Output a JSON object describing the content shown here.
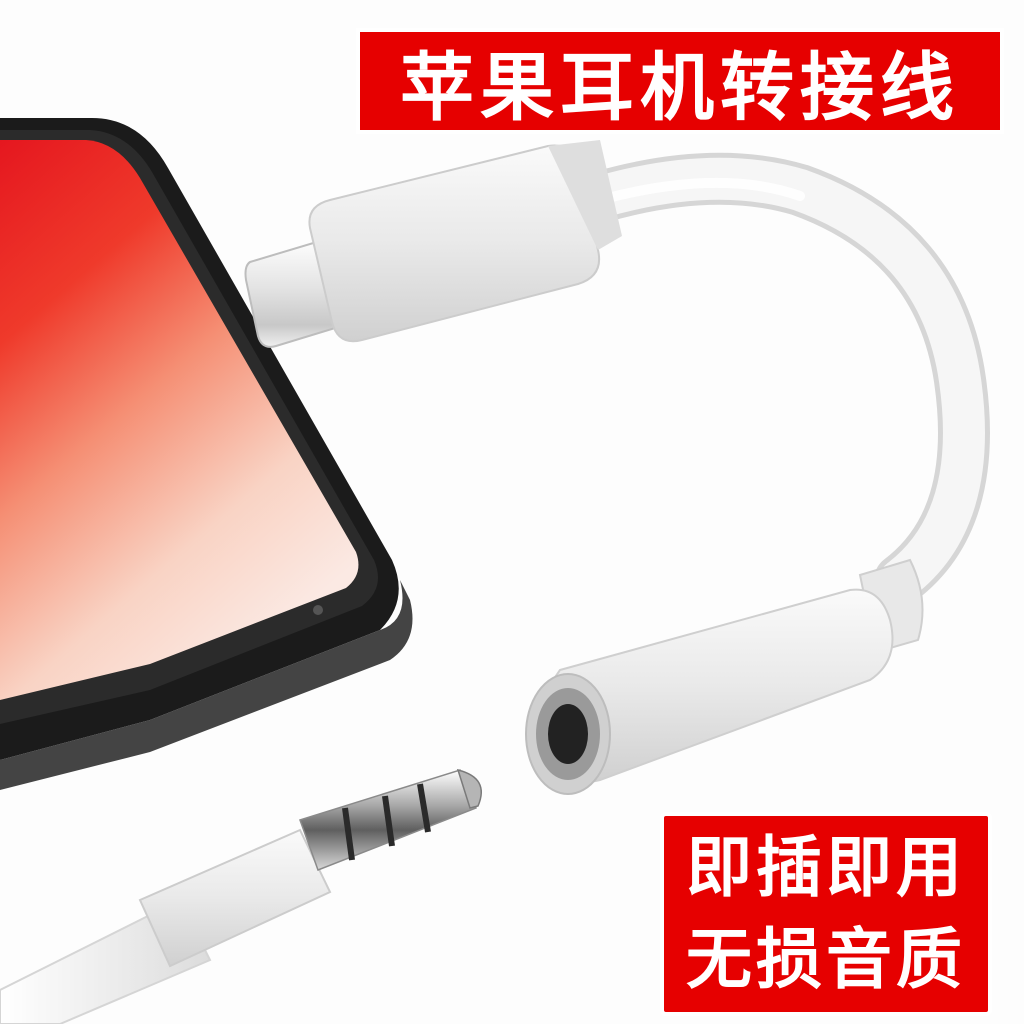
{
  "title": "苹果耳机转接线",
  "features": [
    "即插即用",
    "无损音质"
  ],
  "colors": {
    "banner": "#e60000",
    "banner_text": "#ffffff",
    "cable": "#f2f2f2",
    "phone_body": "#1a1a1a",
    "screen_red": "#e8252a",
    "screen_peach": "#f7b7a0"
  },
  "objects": {
    "phone": "smartphone-with-red-gradient-screen",
    "adapter_plug": "lightning-connector",
    "adapter_socket": "3.5mm-headphone-jack-socket",
    "audio_plug": "3.5mm-trrs-audio-plug"
  }
}
